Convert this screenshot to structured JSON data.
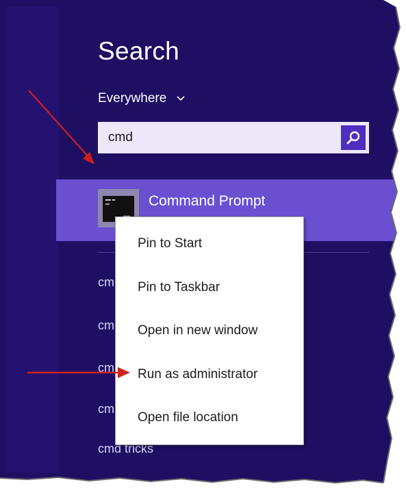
{
  "search_panel": {
    "title": "Search",
    "scope": "Everywhere",
    "query": "cmd"
  },
  "selected_result": {
    "label": "Command Prompt",
    "icon": "command-prompt-icon"
  },
  "other_results": [
    {
      "label": "cmd tricks"
    }
  ],
  "context_menu": {
    "items": [
      {
        "label": "Pin to Start"
      },
      {
        "label": "Pin to Taskbar"
      },
      {
        "label": "Open in new window"
      },
      {
        "label": "Run as administrator"
      },
      {
        "label": "Open file location"
      }
    ]
  },
  "colors": {
    "panel_background": "#1e0f63",
    "selected_result": "#6a4fd1",
    "search_button": "#4f2fbf",
    "annotation_arrow": "#d0201d"
  }
}
